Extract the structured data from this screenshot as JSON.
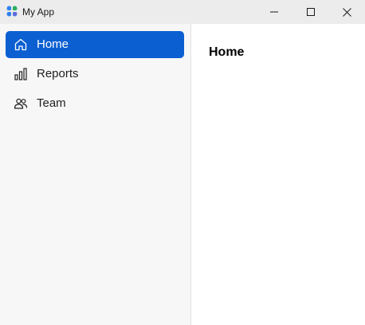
{
  "window": {
    "title": "My App"
  },
  "sidebar": {
    "items": [
      {
        "label": "Home",
        "icon": "home-icon",
        "active": true
      },
      {
        "label": "Reports",
        "icon": "bar-chart-icon",
        "active": false
      },
      {
        "label": "Team",
        "icon": "people-icon",
        "active": false
      }
    ]
  },
  "main": {
    "title": "Home"
  },
  "colors": {
    "accent": "#0b5fd1",
    "sidebar_bg": "#f7f7f7",
    "titlebar_bg": "#ececec"
  }
}
